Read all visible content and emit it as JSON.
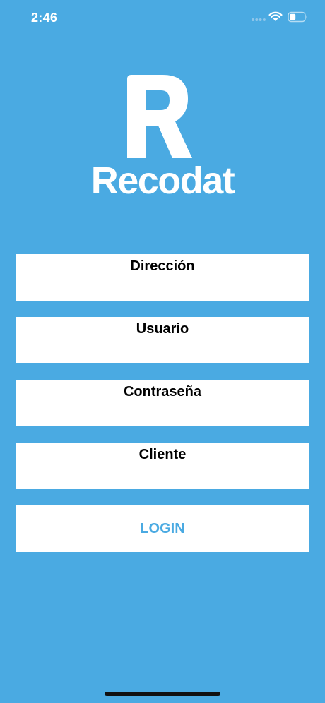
{
  "status_bar": {
    "time": "2:46",
    "icons": [
      "signal-icon",
      "wifi-icon",
      "battery-icon"
    ]
  },
  "logo": {
    "mark_letter": "R",
    "wordmark": "Recodat"
  },
  "form": {
    "fields": [
      {
        "label": "Dirección",
        "value": ""
      },
      {
        "label": "Usuario",
        "value": ""
      },
      {
        "label": "Contraseña",
        "value": ""
      },
      {
        "label": "Cliente",
        "value": ""
      }
    ],
    "login_label": "LOGIN"
  },
  "colors": {
    "background": "#4aaae2",
    "field_background": "#ffffff",
    "accent": "#4aaae2"
  }
}
